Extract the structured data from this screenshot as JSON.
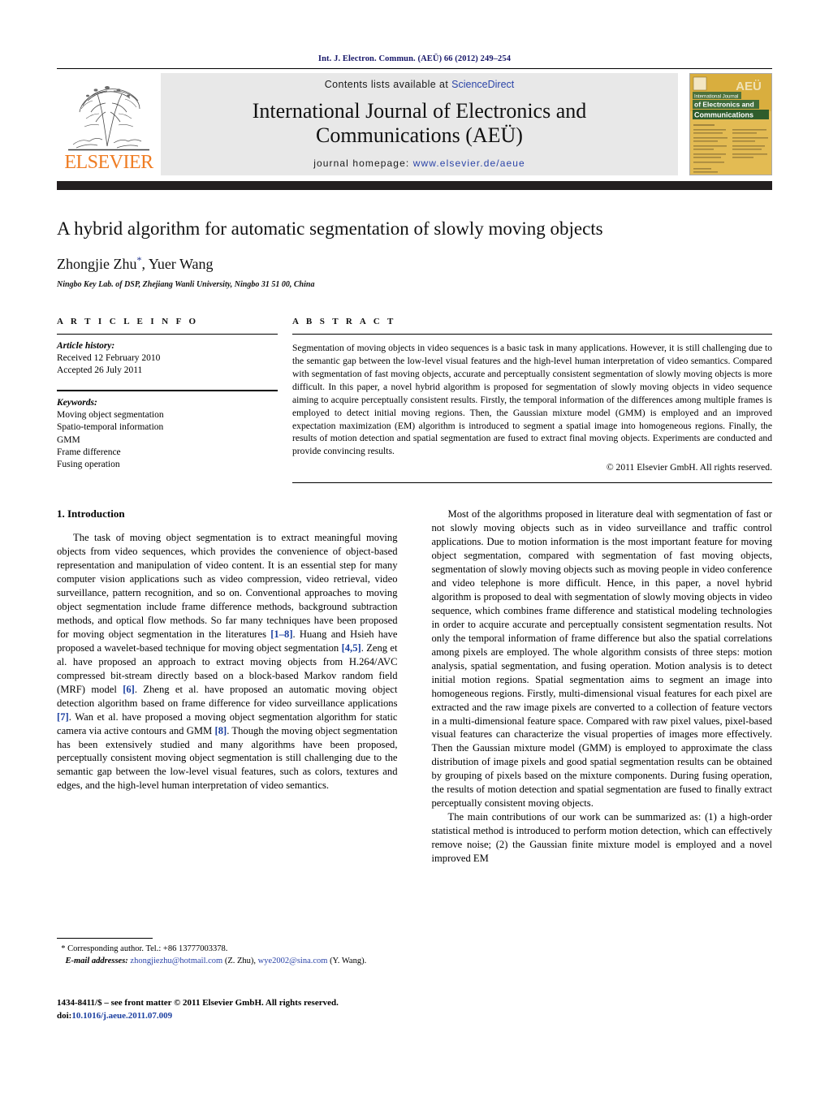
{
  "running_head": "Int. J. Electron. Commun. (AEÜ) 66 (2012) 249–254",
  "masthead": {
    "publisher_name": "ELSEVIER",
    "contents_prefix": "Contents lists available at ",
    "contents_link": "ScienceDirect",
    "journal_title_line1": "International Journal of Electronics and",
    "journal_title_line2": "Communications (AEÜ)",
    "homepage_label": "journal homepage: ",
    "homepage_url": "www.elsevier.de/aeue",
    "cover": {
      "badge": "AEÜ",
      "line1": "International Journal",
      "line2": "of Electronics and",
      "line3": "Communications"
    }
  },
  "article": {
    "title": "A hybrid algorithm for automatic segmentation of slowly moving objects",
    "authors": "Zhongjie Zhu",
    "authors_rest": ", Yuer Wang",
    "corresponding_marker": "*",
    "affiliation": "Ningbo Key Lab. of DSP, Zhejiang Wanli University, Ningbo 31 51 00, China"
  },
  "info": {
    "heading": "A R T I C L E   I N F O",
    "history_label": "Article history:",
    "received": "Received 12 February 2010",
    "accepted": "Accepted 26 July 2011",
    "keywords_label": "Keywords:",
    "keywords": [
      "Moving object segmentation",
      "Spatio-temporal information",
      "GMM",
      "Frame difference",
      "Fusing operation"
    ]
  },
  "abstract": {
    "heading": "A B S T R A C T",
    "text": "Segmentation of moving objects in video sequences is a basic task in many applications. However, it is still challenging due to the semantic gap between the low-level visual features and the high-level human interpretation of video semantics. Compared with segmentation of fast moving objects, accurate and perceptually consistent segmentation of slowly moving objects is more difficult. In this paper, a novel hybrid algorithm is proposed for segmentation of slowly moving objects in video sequence aiming to acquire perceptually consistent results. Firstly, the temporal information of the differences among multiple frames is employed to detect initial moving regions. Then, the Gaussian mixture model (GMM) is employed and an improved expectation maximization (EM) algorithm is introduced to segment a spatial image into homogeneous regions. Finally, the results of motion detection and spatial segmentation are fused to extract final moving objects. Experiments are conducted and provide convincing results.",
    "rights": "© 2011 Elsevier GmbH. All rights reserved."
  },
  "body": {
    "section_number_title": "1.  Introduction",
    "left_p1_a": "The task of moving object segmentation is to extract meaningful moving objects from video sequences, which provides the convenience of object-based representation and manipulation of video content. It is an essential step for many computer vision applications such as video compression, video retrieval, video surveillance, pattern recognition, and so on. Conventional approaches to moving object segmentation include frame difference methods, background subtraction methods, and optical flow methods. So far many techniques have been proposed for moving object segmentation in the literatures ",
    "cite1": "[1–8]",
    "left_p1_b": ". Huang and Hsieh have proposed a wavelet-based technique for moving object segmentation ",
    "cite2": "[4,5]",
    "left_p1_c": ". Zeng et al. have proposed an approach to extract moving objects from H.264/AVC compressed bit-stream directly based on a block-based Markov random field (MRF) model ",
    "cite3": "[6]",
    "left_p1_d": ". Zheng et al. have proposed an automatic moving object detection algorithm based on frame difference for video surveillance applications ",
    "cite4": "[7]",
    "left_p1_e": ". Wan et al. have proposed a moving object segmentation algorithm for static camera via active contours and GMM ",
    "cite5": "[8]",
    "left_p1_f": ". Though the moving object segmentation has been extensively studied and many algorithms have been proposed, perceptually consistent moving object segmentation is still challenging due to the semantic gap between the low-level visual features, such as colors, textures and edges, and the high-level human interpretation of video semantics.",
    "right_p1": "Most of the algorithms proposed in literature deal with segmentation of fast or not slowly moving objects such as in video surveillance and traffic control applications. Due to motion information is the most important feature for moving object segmentation, compared with segmentation of fast moving objects, segmentation of slowly moving objects such as moving people in video conference and video telephone is more difficult. Hence, in this paper, a novel hybrid algorithm is proposed to deal with segmentation of slowly moving objects in video sequence, which combines frame difference and statistical modeling technologies in order to acquire accurate and perceptually consistent segmentation results. Not only the temporal information of frame difference but also the spatial correlations among pixels are employed. The whole algorithm consists of three steps: motion analysis, spatial segmentation, and fusing operation. Motion analysis is to detect initial motion regions. Spatial segmentation aims to segment an image into homogeneous regions. Firstly, multi-dimensional visual features for each pixel are extracted and the raw image pixels are converted to a collection of feature vectors in a multi-dimensional feature space. Compared with raw pixel values, pixel-based visual features can characterize the visual properties of images more effectively. Then the Gaussian mixture model (GMM) is employed to approximate the class distribution of image pixels and good spatial segmentation results can be obtained by grouping of pixels based on the mixture components. During fusing operation, the results of motion detection and spatial segmentation are fused to finally extract perceptually consistent moving objects.",
    "right_p2": "The main contributions of our work can be summarized as: (1) a high-order statistical method is introduced to perform motion detection, which can effectively remove noise; (2) the Gaussian finite mixture model is employed and a novel improved EM"
  },
  "footnote": {
    "marker": "*",
    "corresponding": " Corresponding author. Tel.: +86 13777003378.",
    "email_label": "E-mail addresses:",
    "email1": "zhongjiezhu@hotmail.com",
    "email1_owner": " (Z. Zhu), ",
    "email2": "wye2002@sina.com",
    "email2_owner": "(Y. Wang)."
  },
  "imprint": {
    "line1": "1434-8411/$ – see front matter © 2011 Elsevier GmbH. All rights reserved.",
    "doi_label": "doi:",
    "doi": "10.1016/j.aeue.2011.07.009"
  },
  "colors": {
    "running_head": "#18186a",
    "link": "#2b44a8",
    "citation": "#1b3fa0",
    "elsevier_orange": "#ef7c22",
    "masthead_bg": "#e8e8e8",
    "dark_bar": "#231f20"
  }
}
